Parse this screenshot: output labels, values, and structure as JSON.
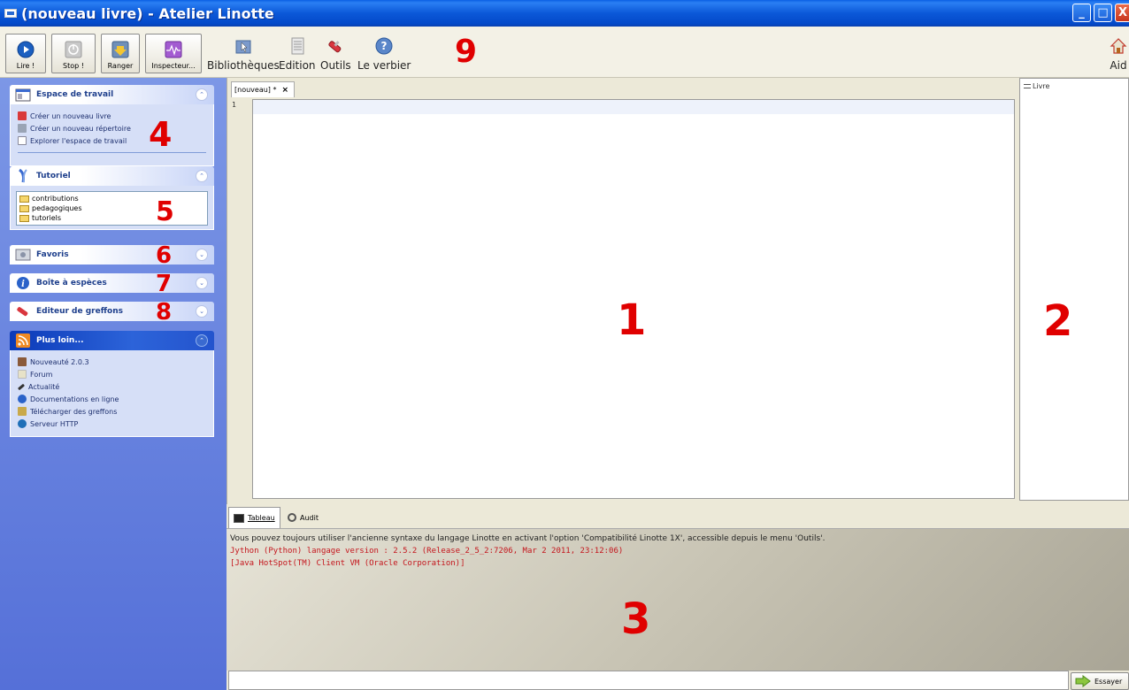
{
  "window": {
    "title": "(nouveau livre) - Atelier Linotte",
    "controls": [
      "_",
      "□",
      "X"
    ]
  },
  "toolbar": {
    "buttons": [
      {
        "label": "Lire !",
        "icon": "play-icon"
      },
      {
        "label": "Stop !",
        "icon": "stop-icon"
      },
      {
        "label": "Ranger",
        "icon": "save-icon"
      },
      {
        "label": "Inspecteur...",
        "icon": "inspector-icon"
      }
    ],
    "menus": [
      {
        "label": "Bibliothèques",
        "icon": "library-icon"
      },
      {
        "label": "Edition",
        "icon": "document-icon"
      },
      {
        "label": "Outils",
        "icon": "tools-icon"
      },
      {
        "label": "Le verbier",
        "icon": "help-icon"
      }
    ],
    "help_label": "Aid"
  },
  "annotations": {
    "n1": "1",
    "n2": "2",
    "n3": "3",
    "n4": "4",
    "n5": "5",
    "n6": "6",
    "n7": "7",
    "n8": "8",
    "n9": "9"
  },
  "sidebar": {
    "workspace": {
      "title": "Espace de travail",
      "items": [
        "Créer un nouveau livre",
        "Créer un nouveau répertoire",
        "Explorer l'espace de travail"
      ]
    },
    "tutorial": {
      "title": "Tutoriel",
      "folders": [
        "contributions",
        "pedagogiques",
        "tutoriels"
      ]
    },
    "favorites": {
      "title": "Favoris"
    },
    "species_box": {
      "title": "Boîte à espèces"
    },
    "plugin_editor": {
      "title": "Editeur de greffons"
    },
    "more": {
      "title": "Plus loin...",
      "items": [
        "Nouveauté 2.0.3",
        "Forum",
        "Actualité",
        "Documentations en ligne",
        "Télécharger des greffons",
        "Serveur HTTP"
      ]
    }
  },
  "editor": {
    "tab_label": "[nouveau] *",
    "tab_close": "×",
    "line_number": "1"
  },
  "right_panel": {
    "title": "Livre"
  },
  "console": {
    "tabs": [
      "Tableau",
      "Audit"
    ],
    "lines": [
      "Vous pouvez toujours utiliser l'ancienne syntaxe du langage Linotte en activant l'option 'Compatibilité Linotte 1X', accessible depuis le menu 'Outils'.",
      "Jython (Python) langage version : 2.5.2 (Release_2_5_2:7206, Mar 2 2011, 23:12:06)",
      "[Java HotSpot(TM) Client VM (Oracle Corporation)]"
    ],
    "try_button": "Essayer"
  }
}
